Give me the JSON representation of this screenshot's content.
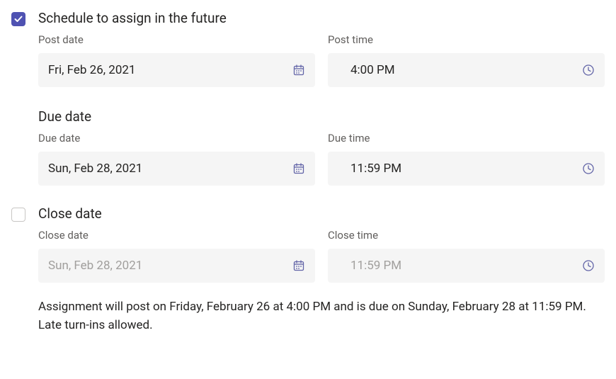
{
  "schedule": {
    "checkbox_checked": true,
    "title": "Schedule to assign in the future",
    "post_date_label": "Post date",
    "post_date_value": "Fri, Feb 26, 2021",
    "post_time_label": "Post time",
    "post_time_value": "4:00 PM"
  },
  "due": {
    "title": "Due date",
    "due_date_label": "Due date",
    "due_date_value": "Sun, Feb 28, 2021",
    "due_time_label": "Due time",
    "due_time_value": "11:59 PM"
  },
  "close": {
    "checkbox_checked": false,
    "title": "Close date",
    "close_date_label": "Close date",
    "close_date_value": "Sun, Feb 28, 2021",
    "close_time_label": "Close time",
    "close_time_value": "11:59 PM"
  },
  "summary": "Assignment will post on Friday, February 26 at 4:00 PM and is due on Sunday, February 28 at 11:59 PM. Late turn-ins allowed."
}
